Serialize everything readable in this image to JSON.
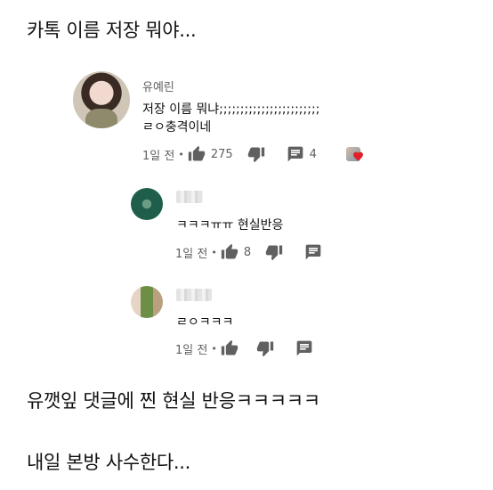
{
  "headlines": {
    "top": "카톡 이름 저장 뭐야...",
    "middle": "유깻잎 댓글에 찐 현실 반응ㅋㅋㅋㅋㅋ",
    "bottom": "내일 본방 사수한다..."
  },
  "main_comment": {
    "author": "유예린",
    "lines": [
      "저장 이름 뭐냐;;;;;;;;;;;;;;;;;;;;;;;;",
      "ㄹㅇ충격이네"
    ],
    "time": "1일 전",
    "dot": "•",
    "likes": "275",
    "replies": "4"
  },
  "replies": [
    {
      "text": "ㅋㅋㅋㅠㅠ 현실반응",
      "time": "1일 전",
      "dot": "•",
      "likes": "8",
      "avatar_color": "#1e5e4a"
    },
    {
      "text": "ㄹㅇㅋㅋㅋ",
      "time": "1일 전",
      "dot": "•",
      "likes": "",
      "avatar_color": "#8a7a55"
    }
  ],
  "colors": {
    "meta": "#606060",
    "icon": "#606060",
    "heart": "#e0202a"
  },
  "icons": [
    "thumbs-up-icon",
    "thumbs-down-icon",
    "reply-icon",
    "creator-heart-icon"
  ]
}
